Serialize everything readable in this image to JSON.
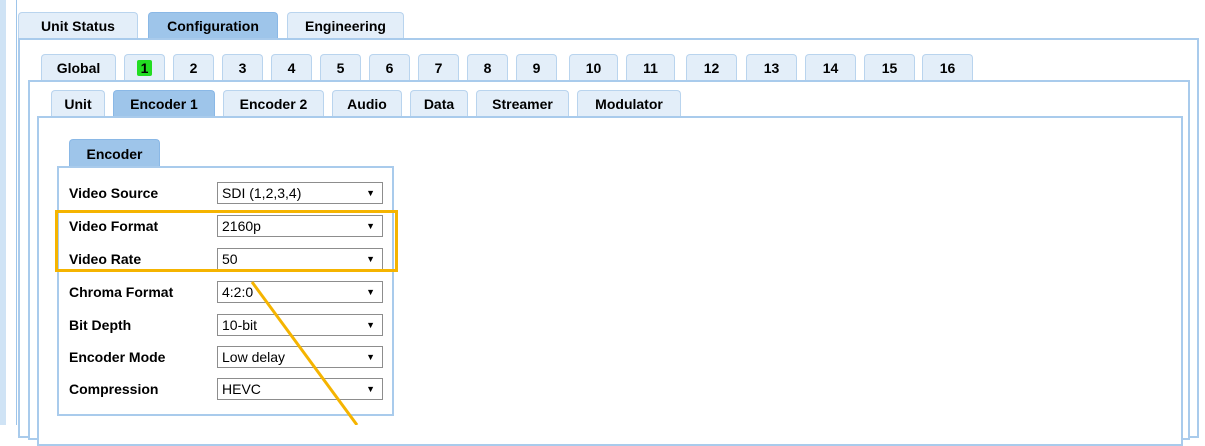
{
  "top_tabs": [
    {
      "label": "Unit Status",
      "active": false
    },
    {
      "label": "Configuration",
      "active": true
    },
    {
      "label": "Engineering",
      "active": false
    }
  ],
  "channel_tabs": {
    "global_label": "Global",
    "numbers": [
      "1",
      "2",
      "3",
      "4",
      "5",
      "6",
      "7",
      "8",
      "9",
      "10",
      "11",
      "12",
      "13",
      "14",
      "15",
      "16"
    ],
    "selected": "1"
  },
  "sub_tabs": [
    {
      "label": "Unit",
      "active": false
    },
    {
      "label": "Encoder 1",
      "active": true
    },
    {
      "label": "Encoder 2",
      "active": false
    },
    {
      "label": "Audio",
      "active": false
    },
    {
      "label": "Data",
      "active": false
    },
    {
      "label": "Streamer",
      "active": false
    },
    {
      "label": "Modulator",
      "active": false
    }
  ],
  "encoder_section": {
    "tab_label": "Encoder",
    "fields": [
      {
        "label": "Video Source",
        "value": "SDI (1,2,3,4)"
      },
      {
        "label": "Video Format",
        "value": "2160p"
      },
      {
        "label": "Video Rate",
        "value": "50"
      },
      {
        "label": "Chroma Format",
        "value": "4:2:0"
      },
      {
        "label": "Bit Depth",
        "value": "10-bit"
      },
      {
        "label": "Encoder Mode",
        "value": "Low delay"
      },
      {
        "label": "Compression",
        "value": "HEVC"
      }
    ]
  },
  "colors": {
    "active_tab": "#9ec5ea",
    "inactive_tab": "#e3eef9",
    "panel_border": "#a9cbec",
    "selected_channel": "#22dd22",
    "highlight": "#f5b400"
  },
  "icons": {
    "dropdown_arrow": "▼"
  }
}
